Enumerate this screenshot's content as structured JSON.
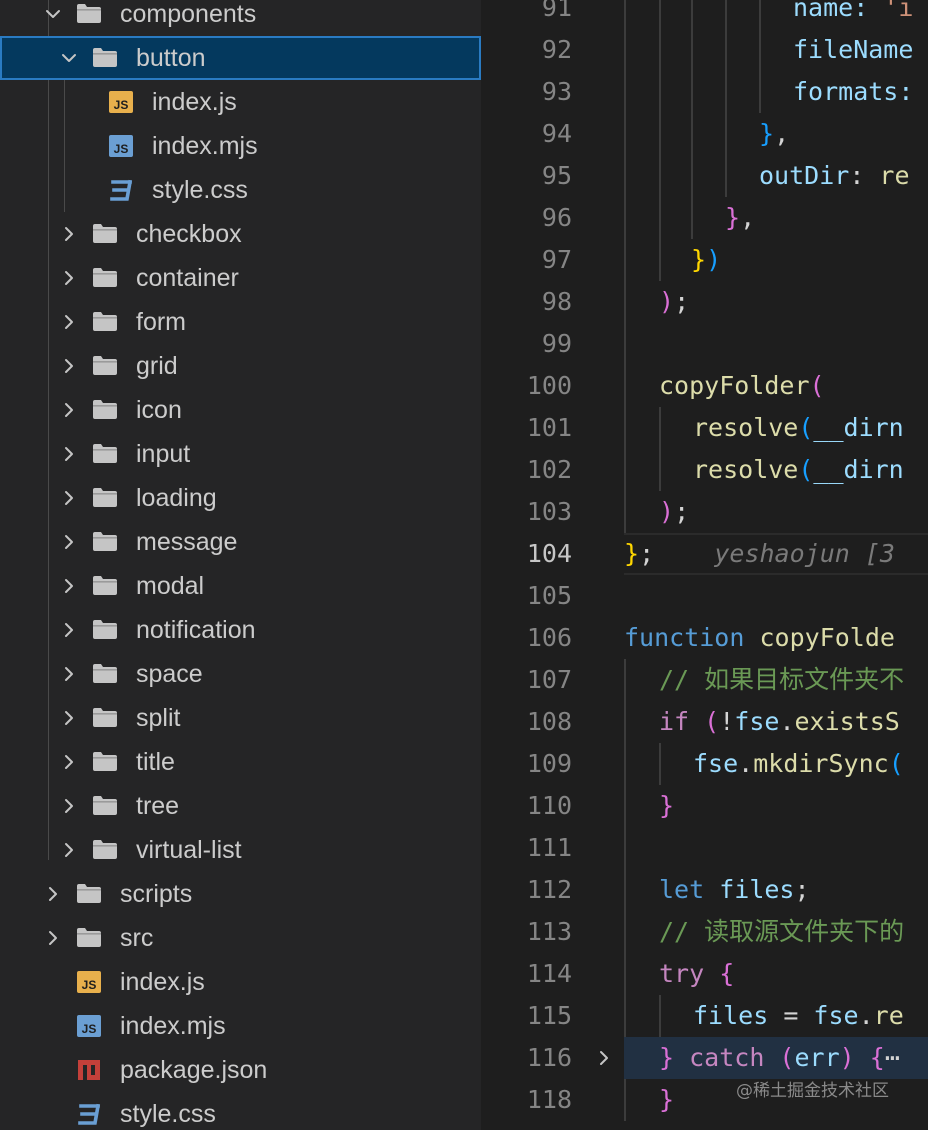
{
  "explorer": {
    "rows": [
      {
        "label": "components",
        "kind": "folder",
        "expanded": true
      },
      {
        "label": "button",
        "kind": "folder",
        "expanded": true,
        "selected": true
      },
      {
        "label": "index.js",
        "kind": "file",
        "icon": "js-file-icon"
      },
      {
        "label": "index.mjs",
        "kind": "file",
        "icon": "mjs-file-icon"
      },
      {
        "label": "style.css",
        "kind": "file",
        "icon": "css-file-icon"
      },
      {
        "label": "checkbox",
        "kind": "folder",
        "expanded": false
      },
      {
        "label": "container",
        "kind": "folder",
        "expanded": false
      },
      {
        "label": "form",
        "kind": "folder",
        "expanded": false
      },
      {
        "label": "grid",
        "kind": "folder",
        "expanded": false
      },
      {
        "label": "icon",
        "kind": "folder",
        "expanded": false
      },
      {
        "label": "input",
        "kind": "folder",
        "expanded": false
      },
      {
        "label": "loading",
        "kind": "folder",
        "expanded": false
      },
      {
        "label": "message",
        "kind": "folder",
        "expanded": false
      },
      {
        "label": "modal",
        "kind": "folder",
        "expanded": false
      },
      {
        "label": "notification",
        "kind": "folder",
        "expanded": false
      },
      {
        "label": "space",
        "kind": "folder",
        "expanded": false
      },
      {
        "label": "split",
        "kind": "folder",
        "expanded": false
      },
      {
        "label": "title",
        "kind": "folder",
        "expanded": false
      },
      {
        "label": "tree",
        "kind": "folder",
        "expanded": false
      },
      {
        "label": "virtual-list",
        "kind": "folder",
        "expanded": false
      },
      {
        "label": "scripts",
        "kind": "folder",
        "expanded": false
      },
      {
        "label": "src",
        "kind": "folder",
        "expanded": false
      },
      {
        "label": "index.js",
        "kind": "file",
        "icon": "js-file-icon"
      },
      {
        "label": "index.mjs",
        "kind": "file",
        "icon": "mjs-file-icon"
      },
      {
        "label": "package.json",
        "kind": "file",
        "icon": "npm-package-icon"
      },
      {
        "label": "style.css",
        "kind": "file",
        "icon": "css-file-icon"
      }
    ]
  },
  "editor": {
    "active_line": "104",
    "lines": [
      {
        "n": "91",
        "tokens": [
          {
            "t": "name: ",
            "c": "t-var"
          },
          {
            "t": "'i",
            "c": "t-str"
          }
        ]
      },
      {
        "n": "92",
        "tokens": [
          {
            "t": "fileName",
            "c": "t-var"
          }
        ]
      },
      {
        "n": "93",
        "tokens": [
          {
            "t": "formats:",
            "c": "t-var"
          }
        ]
      },
      {
        "n": "94",
        "tokens": [
          {
            "t": "}",
            "c": "t-p3"
          },
          {
            "t": ",",
            "c": "t-pl"
          }
        ]
      },
      {
        "n": "95",
        "tokens": [
          {
            "t": "outDir",
            "c": "t-var"
          },
          {
            "t": ": ",
            "c": "t-pl"
          },
          {
            "t": "re",
            "c": "t-fn"
          }
        ]
      },
      {
        "n": "96",
        "tokens": [
          {
            "t": "}",
            "c": "t-p2"
          },
          {
            "t": ",",
            "c": "t-pl"
          }
        ]
      },
      {
        "n": "97",
        "tokens": [
          {
            "t": "}",
            "c": "t-p1"
          },
          {
            "t": ")",
            "c": "t-p3"
          }
        ]
      },
      {
        "n": "98",
        "tokens": [
          {
            "t": ")",
            "c": "t-p2"
          },
          {
            "t": ";",
            "c": "t-pl"
          }
        ]
      },
      {
        "n": "99",
        "tokens": []
      },
      {
        "n": "100",
        "tokens": [
          {
            "t": "copyFolder",
            "c": "t-fn"
          },
          {
            "t": "(",
            "c": "t-p2"
          }
        ]
      },
      {
        "n": "101",
        "tokens": [
          {
            "t": "resolve",
            "c": "t-fn"
          },
          {
            "t": "(",
            "c": "t-p3"
          },
          {
            "t": "__dirn",
            "c": "t-var"
          }
        ]
      },
      {
        "n": "102",
        "tokens": [
          {
            "t": "resolve",
            "c": "t-fn"
          },
          {
            "t": "(",
            "c": "t-p3"
          },
          {
            "t": "__dirn",
            "c": "t-var"
          }
        ]
      },
      {
        "n": "103",
        "tokens": [
          {
            "t": ")",
            "c": "t-p2"
          },
          {
            "t": ";",
            "c": "t-pl"
          }
        ]
      },
      {
        "n": "104",
        "tokens": [
          {
            "t": "}",
            "c": "t-p1"
          },
          {
            "t": ";",
            "c": "t-pl"
          }
        ],
        "blame": "yeshaojun [3"
      },
      {
        "n": "105",
        "tokens": []
      },
      {
        "n": "106",
        "tokens": [
          {
            "t": "function ",
            "c": "t-kw"
          },
          {
            "t": "copyFolde",
            "c": "t-fn"
          }
        ]
      },
      {
        "n": "107",
        "tokens": [
          {
            "t": "// 如果目标文件夹不",
            "c": "t-cm"
          }
        ]
      },
      {
        "n": "108",
        "tokens": [
          {
            "t": "if ",
            "c": "t-ctl"
          },
          {
            "t": "(",
            "c": "t-p2"
          },
          {
            "t": "!",
            "c": "t-pl"
          },
          {
            "t": "fse",
            "c": "t-var"
          },
          {
            "t": ".",
            "c": "t-pl"
          },
          {
            "t": "existsS",
            "c": "t-fn"
          }
        ]
      },
      {
        "n": "109",
        "tokens": [
          {
            "t": "fse",
            "c": "t-var"
          },
          {
            "t": ".",
            "c": "t-pl"
          },
          {
            "t": "mkdirSync",
            "c": "t-fn"
          },
          {
            "t": "(",
            "c": "t-p3"
          }
        ]
      },
      {
        "n": "110",
        "tokens": [
          {
            "t": "}",
            "c": "t-p2"
          }
        ]
      },
      {
        "n": "111",
        "tokens": []
      },
      {
        "n": "112",
        "tokens": [
          {
            "t": "let ",
            "c": "t-kw"
          },
          {
            "t": "files",
            "c": "t-var"
          },
          {
            "t": ";",
            "c": "t-pl"
          }
        ]
      },
      {
        "n": "113",
        "tokens": [
          {
            "t": "// 读取源文件夹下的",
            "c": "t-cm"
          }
        ]
      },
      {
        "n": "114",
        "tokens": [
          {
            "t": "try ",
            "c": "t-ctl"
          },
          {
            "t": "{",
            "c": "t-p2"
          }
        ]
      },
      {
        "n": "115",
        "tokens": [
          {
            "t": "files",
            "c": "t-var"
          },
          {
            "t": " = ",
            "c": "t-pl"
          },
          {
            "t": "fse",
            "c": "t-var"
          },
          {
            "t": ".",
            "c": "t-pl"
          },
          {
            "t": "re",
            "c": "t-fn"
          }
        ]
      },
      {
        "n": "116",
        "tokens": [
          {
            "t": "} ",
            "c": "t-p2"
          },
          {
            "t": "catch ",
            "c": "t-ctl"
          },
          {
            "t": "(",
            "c": "t-p2"
          },
          {
            "t": "err",
            "c": "t-var"
          },
          {
            "t": ") ",
            "c": "t-p2"
          },
          {
            "t": "{",
            "c": "t-p2"
          },
          {
            "t": "⋯",
            "c": "t-pl"
          }
        ],
        "folded": true
      },
      {
        "n": "118",
        "tokens": [
          {
            "t": "}",
            "c": "t-p2"
          }
        ]
      }
    ]
  },
  "watermark": "@稀土掘金技术社区",
  "colors": {
    "sidebar_bg": "#252526",
    "editor_bg": "#1e1e1e",
    "selection_bg": "#04395e",
    "selection_border": "#2a7bc2",
    "js_icon": "#e8b04c",
    "mjs_icon": "#6b9fd3",
    "css_icon": "#6a9fd4",
    "npm_icon": "#c4403a"
  }
}
